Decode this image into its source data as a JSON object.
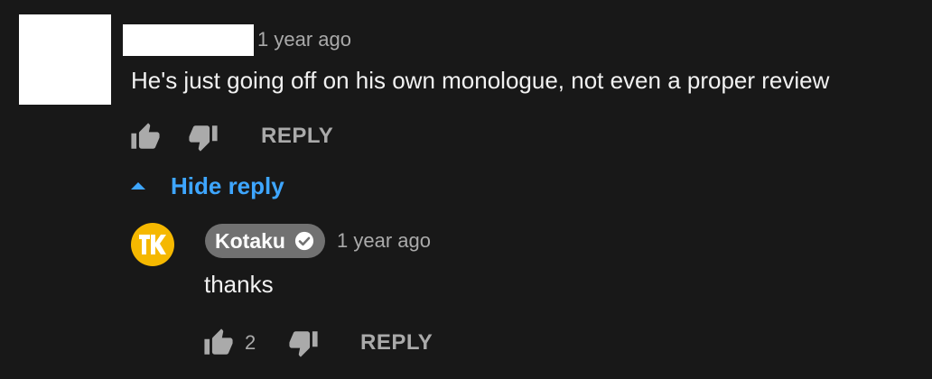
{
  "parent_comment": {
    "timestamp": "1 year ago",
    "text": "He's just going off on his own monologue, not even a proper review",
    "actions": {
      "like_icon": "thumb-up-icon",
      "dislike_icon": "thumb-down-icon",
      "reply_label": "REPLY"
    }
  },
  "replies_toggle": {
    "label": "Hide reply",
    "icon": "caret-up-icon",
    "color": "#3ea6ff"
  },
  "reply": {
    "author": "Kotaku",
    "verified": true,
    "avatar_icon": "kotaku-logo",
    "avatar_color": "#f5b800",
    "timestamp": "1 year ago",
    "text": "thanks",
    "actions": {
      "like_count": "2",
      "like_icon": "thumb-up-icon",
      "dislike_icon": "thumb-down-icon",
      "reply_label": "REPLY"
    }
  },
  "colors": {
    "background": "#181818",
    "primary_text": "#f1f1f1",
    "secondary_text": "#aaaaaa",
    "link": "#3ea6ff"
  }
}
